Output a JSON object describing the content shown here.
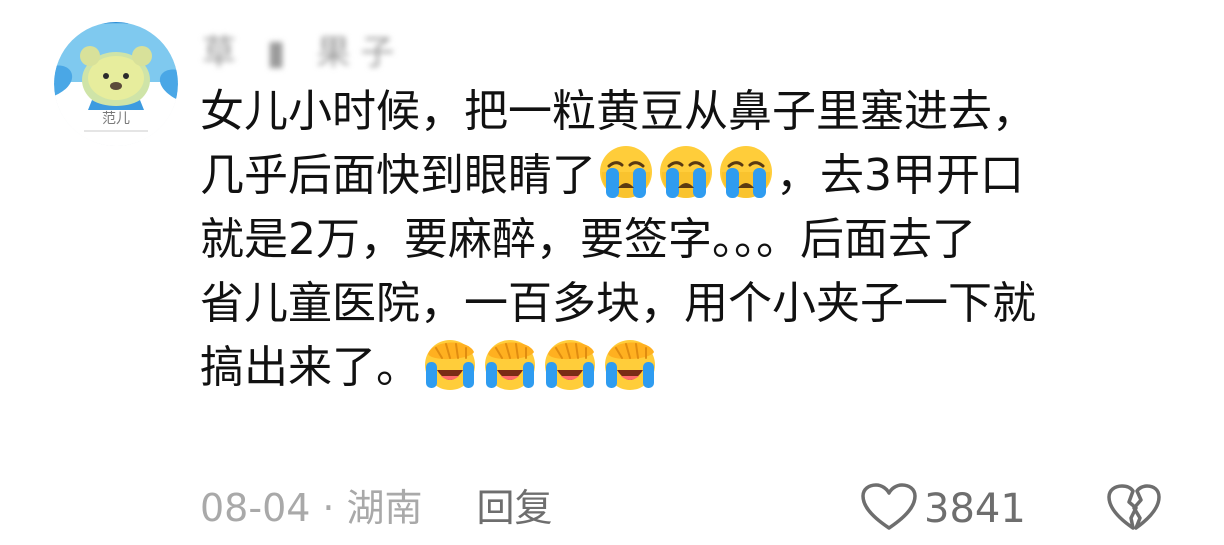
{
  "comment": {
    "username": "草 ▮ 果子",
    "avatar": {
      "label": "范儿",
      "icon": "teddy-bear-avatar"
    },
    "lines": {
      "l1": {
        "text": "女儿小时候，把一粒黄豆从鼻子里塞进去，"
      },
      "l2": {
        "before": "几乎后面快到眼睛了",
        "after": "，去3甲开口",
        "emoji": "loudly-crying-face",
        "emoji_count": 3
      },
      "l3": {
        "text": "就是2万，要麻醉，要签字。。。后面去了"
      },
      "l4": {
        "text": "省儿童医院，一百多块，用个小夹子一下就"
      },
      "l5": {
        "before": "搞出来了。",
        "emoji": "face-palm-laughing",
        "emoji_count": 4
      }
    },
    "meta": {
      "date": "08-04",
      "separator": "·",
      "location": "湖南",
      "reply_label": "回复"
    },
    "likes": {
      "count": "3841",
      "icon": "heart-outline-icon"
    },
    "dislike": {
      "icon": "broken-heart-icon"
    }
  },
  "colors": {
    "secondary_text": "#a9a9a9",
    "action_text": "#6e6e6e",
    "emoji_yellow": "#ffcd3a",
    "emoji_blue": "#2f9cf0"
  }
}
